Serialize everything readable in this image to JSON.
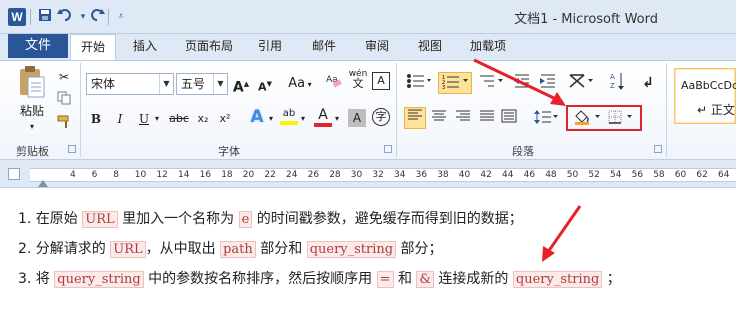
{
  "window": {
    "title": "文档1 - Microsoft Word",
    "logo_letter": "W"
  },
  "quick_access": {
    "save_icon": "save-icon",
    "undo_icon": "undo-icon",
    "redo_icon": "redo-icon",
    "customize_icon": "customize-dropdown-icon"
  },
  "tabs": [
    "文件",
    "开始",
    "插入",
    "页面布局",
    "引用",
    "邮件",
    "审阅",
    "视图",
    "加载项"
  ],
  "active_tab": "开始",
  "ribbon": {
    "clipboard": {
      "label": "剪贴板",
      "paste": "粘贴",
      "cut_icon": "cut-icon",
      "copy_icon": "copy-icon",
      "format_painter_icon": "format-painter-icon"
    },
    "font": {
      "label": "字体",
      "font_name": "宋体",
      "font_size": "五号",
      "grow": "A",
      "shrink": "A",
      "case": "Aa",
      "clear_icon": "clear-format-icon",
      "phonetic": "wén",
      "border_char_icon": "character-border-icon",
      "bold": "B",
      "italic": "I",
      "underline": "U",
      "strike": "abc",
      "subscript": "x₂",
      "superscript": "x²",
      "text_effect": "A",
      "highlight": "ab",
      "font_color": "A",
      "shading": "A",
      "enclose": "字"
    },
    "paragraph": {
      "label": "段落",
      "bullets_icon": "bullets-icon",
      "numbering_icon": "numbering-icon",
      "multilevel_icon": "multilevel-list-icon",
      "decrease_indent_icon": "decrease-indent-icon",
      "increase_indent_icon": "increase-indent-icon",
      "chinese_layout_icon": "chinese-layout-icon",
      "sort_icon": "sort-icon",
      "show_marks_icon": "show-marks-icon",
      "align_left_icon": "align-left-icon",
      "center_icon": "align-center-icon",
      "align_right_icon": "align-right-icon",
      "justify_icon": "justify-icon",
      "distributed_icon": "distributed-icon",
      "line_spacing_icon": "line-spacing-icon",
      "shading_icon": "shading-bucket-icon",
      "borders_icon": "borders-icon"
    },
    "styles": {
      "preview": "AaBbCcDc",
      "name": "↵ 正文"
    }
  },
  "ruler_numbers": [
    "4",
    "6",
    "8",
    "10",
    "12",
    "14",
    "16",
    "18",
    "20",
    "22",
    "24",
    "26",
    "28",
    "30",
    "32",
    "34",
    "36",
    "38",
    "40",
    "42",
    "44",
    "46",
    "48",
    "50",
    "52",
    "54",
    "56",
    "58",
    "60",
    "62",
    "64"
  ],
  "document": {
    "line1": {
      "a": "1. 在原始 ",
      "b": "URL",
      "c": " 里加入一个名称为 ",
      "d": "e",
      "e": " 的时间戳参数，避免缓存而得到旧的数据；"
    },
    "line2": {
      "a": "2. 分解请求的 ",
      "b": "URL",
      "c": "，从中取出 ",
      "d": "path",
      "e": " 部分和 ",
      "f": "query_string",
      "g": " 部分；"
    },
    "line3": {
      "a": "3. 将 ",
      "b": "query_string",
      "c": " 中的参数按名称排序，然后按顺序用 ",
      "d": "=",
      "e": " 和 ",
      "f": "&",
      "g": " 连接成新的 ",
      "h": "query_string",
      "i": " ；"
    }
  },
  "colors": {
    "accent": "#2a5699",
    "annotation_red": "#e0242b",
    "code_bg": "#fbeaea"
  }
}
